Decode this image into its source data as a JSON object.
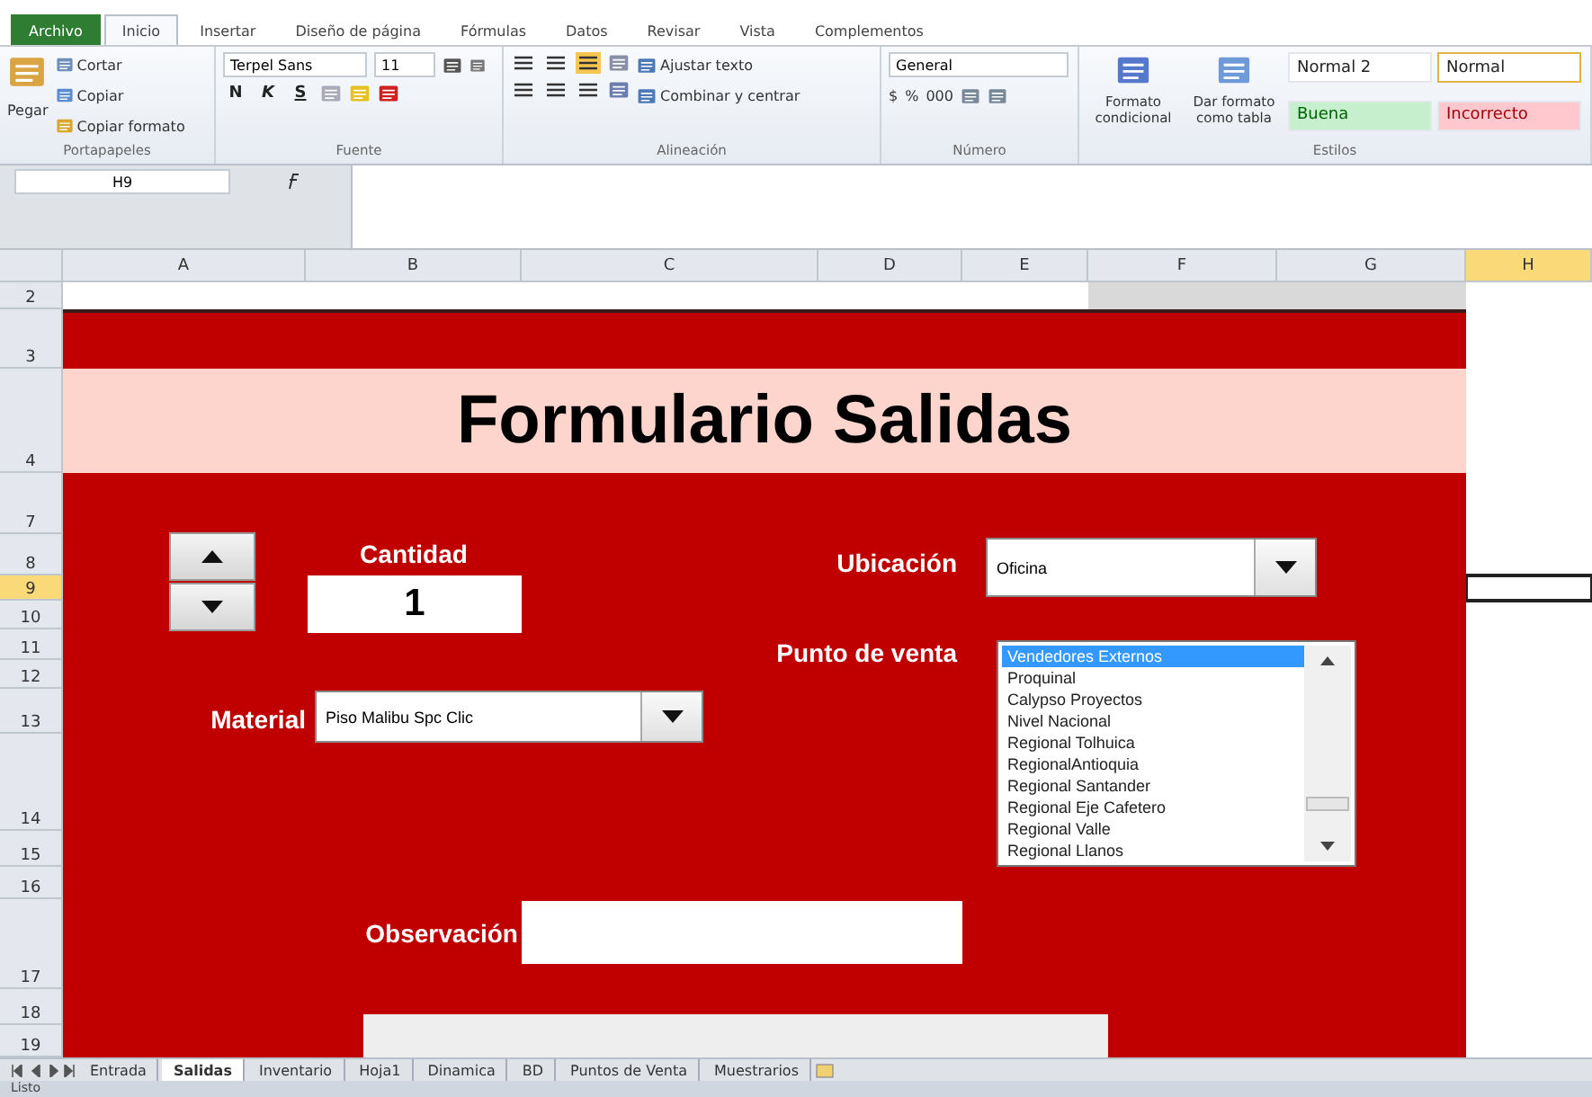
{
  "ribbon_tabs": [
    {
      "label": "Archivo",
      "kind": "file",
      "selected": false
    },
    {
      "label": "Inicio",
      "kind": "tab",
      "selected": true
    },
    {
      "label": "Insertar",
      "kind": "tab",
      "selected": false
    },
    {
      "label": "Diseño de página",
      "kind": "tab",
      "selected": false
    },
    {
      "label": "Fórmulas",
      "kind": "tab",
      "selected": false
    },
    {
      "label": "Datos",
      "kind": "tab",
      "selected": false
    },
    {
      "label": "Revisar",
      "kind": "tab",
      "selected": false
    },
    {
      "label": "Vista",
      "kind": "tab",
      "selected": false
    },
    {
      "label": "Complementos",
      "kind": "tab",
      "selected": false
    }
  ],
  "clipboard": {
    "paste": "Pegar",
    "cut": "Cortar",
    "copy": "Copiar",
    "format_painter": "Copiar formato",
    "group": "Portapapeles"
  },
  "font": {
    "name": "Terpel Sans",
    "size": "11",
    "bold": "N",
    "italic": "K",
    "underline": "S",
    "group": "Fuente"
  },
  "alignment": {
    "wrap": "Ajustar texto",
    "merge": "Combinar y centrar",
    "group": "Alineación"
  },
  "number": {
    "format": "General",
    "currency": "$",
    "percent": "%",
    "thousands": "000",
    "group": "Número"
  },
  "styles": {
    "conditional": "Formato condicional",
    "table": "Dar formato como tabla",
    "group": "Estilos",
    "cells": [
      {
        "label": "Normal 2",
        "color": "#ffffff",
        "selected": false
      },
      {
        "label": "Normal",
        "color": "#ffffff",
        "selected": true
      },
      {
        "label": "Buena",
        "color": "#c6efce",
        "selected": false
      },
      {
        "label": "Incorrecto",
        "color": "#ffc7ce",
        "selected": false
      }
    ]
  },
  "formula_bar": {
    "name_box": "H9"
  },
  "columns": [
    {
      "label": "A",
      "selected": false
    },
    {
      "label": "B",
      "selected": false
    },
    {
      "label": "C",
      "selected": false
    },
    {
      "label": "D",
      "selected": false
    },
    {
      "label": "E",
      "selected": false
    },
    {
      "label": "F",
      "selected": false
    },
    {
      "label": "G",
      "selected": false
    },
    {
      "label": "H",
      "selected": true
    }
  ],
  "rows": [
    {
      "label": "2",
      "selected": false
    },
    {
      "label": "3",
      "selected": false
    },
    {
      "label": "4",
      "selected": false
    },
    {
      "label": "7",
      "selected": false
    },
    {
      "label": "8",
      "selected": false
    },
    {
      "label": "9",
      "selected": true
    },
    {
      "label": "10",
      "selected": false
    },
    {
      "label": "11",
      "selected": false
    },
    {
      "label": "12",
      "selected": false
    },
    {
      "label": "13",
      "selected": false
    },
    {
      "label": "14",
      "selected": false
    },
    {
      "label": "15",
      "selected": false
    },
    {
      "label": "16",
      "selected": false
    },
    {
      "label": "17",
      "selected": false
    },
    {
      "label": "18",
      "selected": false
    },
    {
      "label": "19",
      "selected": false
    }
  ],
  "form": {
    "title": "Formulario Salidas",
    "quantity_label": "Cantidad",
    "quantity": "1",
    "location_label": "Ubicación",
    "location": "Oficina",
    "sales_point_label": "Punto de venta",
    "material_label": "Material",
    "material": "Piso Malibu Spc Clic",
    "observation_label": "Observación",
    "sales_points": [
      {
        "label": "Vendedores Externos",
        "selected": true
      },
      {
        "label": "Proquinal",
        "selected": false
      },
      {
        "label": "Calypso Proyectos",
        "selected": false
      },
      {
        "label": "Nivel Nacional",
        "selected": false
      },
      {
        "label": "Regional Tolhuica",
        "selected": false
      },
      {
        "label": "RegionalAntioquia",
        "selected": false
      },
      {
        "label": "Regional Santander",
        "selected": false
      },
      {
        "label": "Regional Eje Cafetero",
        "selected": false
      },
      {
        "label": "Regional Valle",
        "selected": false
      },
      {
        "label": "Regional Llanos",
        "selected": false
      }
    ]
  },
  "sheet_tabs": [
    {
      "label": "Entrada",
      "selected": false
    },
    {
      "label": "Salidas",
      "selected": true
    },
    {
      "label": "Inventario",
      "selected": false
    },
    {
      "label": "Hoja1",
      "selected": false
    },
    {
      "label": "Dinamica",
      "selected": false
    },
    {
      "label": "BD",
      "selected": false
    },
    {
      "label": "Puntos de Venta",
      "selected": false
    },
    {
      "label": "Muestrarios",
      "selected": false
    }
  ],
  "status_bar": {
    "text": "Listo"
  }
}
